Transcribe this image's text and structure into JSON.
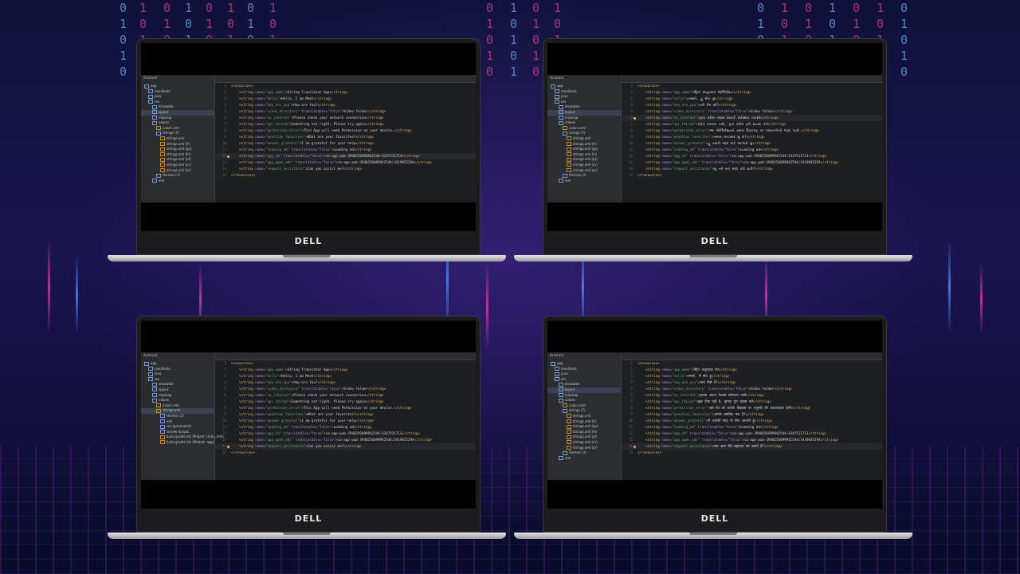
{
  "brand": "DELL",
  "sidebar": {
    "header": "Android",
    "tree_a": [
      {
        "label": "app"
      },
      {
        "label": "manifests"
      },
      {
        "label": "java"
      },
      {
        "label": "res"
      },
      {
        "label": "drawable"
      },
      {
        "label": "layout"
      },
      {
        "label": "mipmap"
      },
      {
        "label": "values"
      },
      {
        "label": "colors.xml"
      },
      {
        "label": "strings (7)"
      },
      {
        "label": "strings.xml"
      },
      {
        "label": "strings.xml (fr)"
      },
      {
        "label": "strings.xml (gu)"
      },
      {
        "label": "strings.xml (hi)"
      },
      {
        "label": "strings.xml (pt)"
      },
      {
        "label": "strings.xml (ur)"
      },
      {
        "label": "strings.xml (ar)"
      },
      {
        "label": "themes (2)"
      },
      {
        "label": "xml"
      }
    ],
    "tree_c": [
      {
        "label": "app"
      },
      {
        "label": "manifests"
      },
      {
        "label": "java"
      },
      {
        "label": "res"
      },
      {
        "label": "drawable"
      },
      {
        "label": "layout"
      },
      {
        "label": "mipmap"
      },
      {
        "label": "values"
      },
      {
        "label": "colors.xml"
      },
      {
        "label": "strings.xml"
      },
      {
        "label": "themes (2)"
      },
      {
        "label": "xml"
      },
      {
        "label": "res (generated)"
      },
      {
        "label": "Gradle Scripts"
      },
      {
        "label": "build.gradle.kts (Project: Unity_Ads)"
      },
      {
        "label": "build.gradle.kts (Module :app)"
      }
    ]
  },
  "tabs_a": [
    "values/strings.xml",
    "gu/strings.xml",
    "hi/strings.xml",
    "pt/strings.xml",
    "ur/strings.xml",
    "ar/strings.xml"
  ],
  "tabs_c": [
    "strings.xml"
  ],
  "code": {
    "open": "<resources>",
    "close": "</resources>",
    "lines": [
      {
        "name": "app_name",
        "attr": "",
        "value": "String Translator App"
      },
      {
        "name": "hello",
        "attr": "",
        "value": "Hello, I am Meet"
      },
      {
        "name": "how_are_you",
        "attr": "",
        "value": "How are You?"
      },
      {
        "name": "video_directory",
        "attr": " translatable=\"false\"",
        "value": "Video folder"
      },
      {
        "name": "no_internet",
        "attr": "",
        "value": "Please check your network connection"
      },
      {
        "name": "api_failed",
        "attr": "",
        "value": "Something not right, Please try again"
      },
      {
        "name": "permission_error",
        "attr": "",
        "value": "This App will need Permission on your device."
      },
      {
        "name": "question_favorites",
        "attr": "",
        "value": "What are your favorites?"
      },
      {
        "name": "answer_grateful",
        "attr": "",
        "value": "I am grateful for your help"
      },
      {
        "name": "loading_ad",
        "attr": " translatable=\"false\"",
        "value": "Loading ad"
      },
      {
        "name": "app_id",
        "attr": " translatable=\"false\"",
        "value": "ca-app-pub-3940256099942544~3347511713"
      },
      {
        "name": "app_open_ads",
        "attr": " translatable=\"false\"",
        "value": "ca-app-pub-3940256099942544/3419835294"
      },
      {
        "name": "request_assistance",
        "attr": "",
        "value": "Can you assist me?"
      }
    ]
  },
  "code_gu": {
    "lines": [
      {
        "name": "app_name",
        "attr": "",
        "value": "સ્ટ્રિંગ અનુવાદક એપ્લિકેશન"
      },
      {
        "name": "hello",
        "attr": "",
        "value": "નમસ્તે, હું મીત છું"
      },
      {
        "name": "how_are_you",
        "attr": "",
        "value": "તમે કેમ છો?"
      },
      {
        "name": "video_directory",
        "attr": " translatable=\"false\"",
        "value": "Video folder"
      },
      {
        "name": "no_internet",
        "attr": "",
        "value": "કૃપા કરીને તમારું નેટવર્ક કનેક્શન તપાસો"
      },
      {
        "name": "api_failed",
        "attr": "",
        "value": "કંઈક બરાબર નથી, કૃપા કરીને ફરી પ્રયાસ કરો"
      },
      {
        "name": "permission_error",
        "attr": "",
        "value": "આ એપ્લિકેશનને તમારા ઉપકરણ પર પરવાનગીની જરૂર પડશે."
      },
      {
        "name": "question_favorites",
        "attr": "",
        "value": "તમારા મનપસંદ શું છે?"
      },
      {
        "name": "answer_grateful",
        "attr": "",
        "value": "હું તમારી મદદ માટે આભારી છું"
      },
      {
        "name": "loading_ad",
        "attr": " translatable=\"false\"",
        "value": "Loading ad"
      },
      {
        "name": "app_id",
        "attr": " translatable=\"false\"",
        "value": "ca-app-pub-3940256099942544~3347511713"
      },
      {
        "name": "app_open_ads",
        "attr": " translatable=\"false\"",
        "value": "ca-app-pub-3940256099942544/3419835294"
      },
      {
        "name": "request_assistance",
        "attr": "",
        "value": "શું તમે મને મદદ કરી શકો?"
      }
    ]
  },
  "code_hi": {
    "lines": [
      {
        "name": "app_name",
        "attr": "",
        "value": "स्ट्रिंग अनुवादक ऐप"
      },
      {
        "name": "hello",
        "attr": "",
        "value": "नमस्ते, मैं मीत हूं"
      },
      {
        "name": "how_are_you",
        "attr": "",
        "value": "आप कैसे हैं?"
      },
      {
        "name": "video_directory",
        "attr": " translatable=\"false\"",
        "value": "Video folder"
      },
      {
        "name": "no_internet",
        "attr": "",
        "value": "कृपया अपना नेटवर्क कनेक्शन जांचें"
      },
      {
        "name": "api_failed",
        "attr": "",
        "value": "कुछ ठीक नहीं है, कृपया पुनः प्रयास करें"
      },
      {
        "name": "permission_error",
        "attr": "",
        "value": "इस ऐप को आपके डिवाइस पर अनुमति की आवश्यकता होगी।"
      },
      {
        "name": "question_favorites",
        "attr": "",
        "value": "आपके पसंदीदा क्या हैं?"
      },
      {
        "name": "answer_grateful",
        "attr": "",
        "value": "मैं आपकी मदद के लिए आभारी हूं"
      },
      {
        "name": "loading_ad",
        "attr": " translatable=\"false\"",
        "value": "Loading ad"
      },
      {
        "name": "app_id",
        "attr": " translatable=\"false\"",
        "value": "ca-app-pub-3940256099942544~3347511713"
      },
      {
        "name": "app_open_ads",
        "attr": " translatable=\"false\"",
        "value": "ca-app-pub-3940256099942544/3419835294"
      },
      {
        "name": "request_assistance",
        "attr": "",
        "value": "क्या आप मेरी सहायता कर सकते हैं?"
      }
    ]
  },
  "colors": {
    "accent": "#4a88c7",
    "tag": "#e7b66b",
    "attr": "#b48ed8",
    "string": "#6aab73"
  }
}
